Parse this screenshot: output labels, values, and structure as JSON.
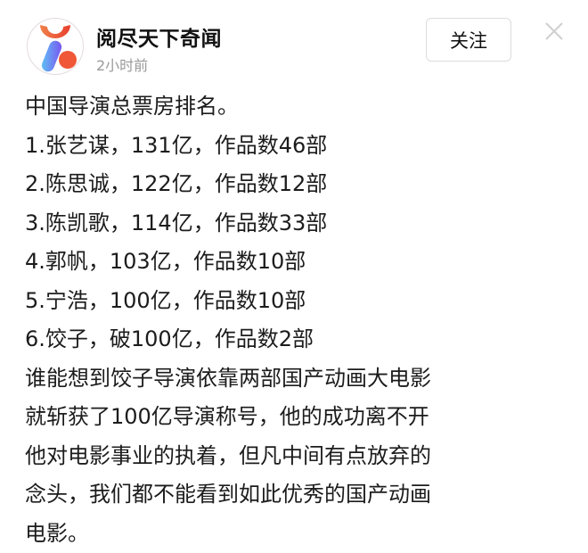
{
  "post": {
    "author": "阅尽天下奇闻",
    "time": "2小时前",
    "follow_label": "关注",
    "close_icon": "close-icon",
    "avatar_icon": "brand-logo-icon",
    "title": "中国导演总票房排名。",
    "rankings": [
      {
        "line": "1.张艺谋，131亿，作品数46部",
        "rank": 1,
        "name": "张艺谋",
        "box_office": "131亿",
        "works": "46部"
      },
      {
        "line": "2.陈思诚，122亿，作品数12部",
        "rank": 2,
        "name": "陈思诚",
        "box_office": "122亿",
        "works": "12部"
      },
      {
        "line": "3.陈凯歌，114亿，作品数33部",
        "rank": 3,
        "name": "陈凯歌",
        "box_office": "114亿",
        "works": "33部"
      },
      {
        "line": "4.郭帆，103亿，作品数10部",
        "rank": 4,
        "name": "郭帆",
        "box_office": "103亿",
        "works": "10部"
      },
      {
        "line": "5.宁浩，100亿，作品数10部",
        "rank": 5,
        "name": "宁浩",
        "box_office": "100亿",
        "works": "10部"
      },
      {
        "line": "6.饺子，破100亿，作品数2部",
        "rank": 6,
        "name": "饺子",
        "box_office": "破100亿",
        "works": "2部"
      }
    ],
    "paragraph": "谁能想到饺子导演依靠两部国产动画大电影就斩获了100亿导演称号，他的成功离不开他对电影事业的执着，但凡中间有点放弃的念头，我们都不能看到如此优秀的国产动画电影。"
  },
  "colors": {
    "logo_orange": "#f0543a",
    "logo_blue": "#6a5cf0",
    "logo_cyan": "#5ec8f5",
    "time_gray": "#9a9a9a",
    "border_gray": "#dcdcdc"
  }
}
